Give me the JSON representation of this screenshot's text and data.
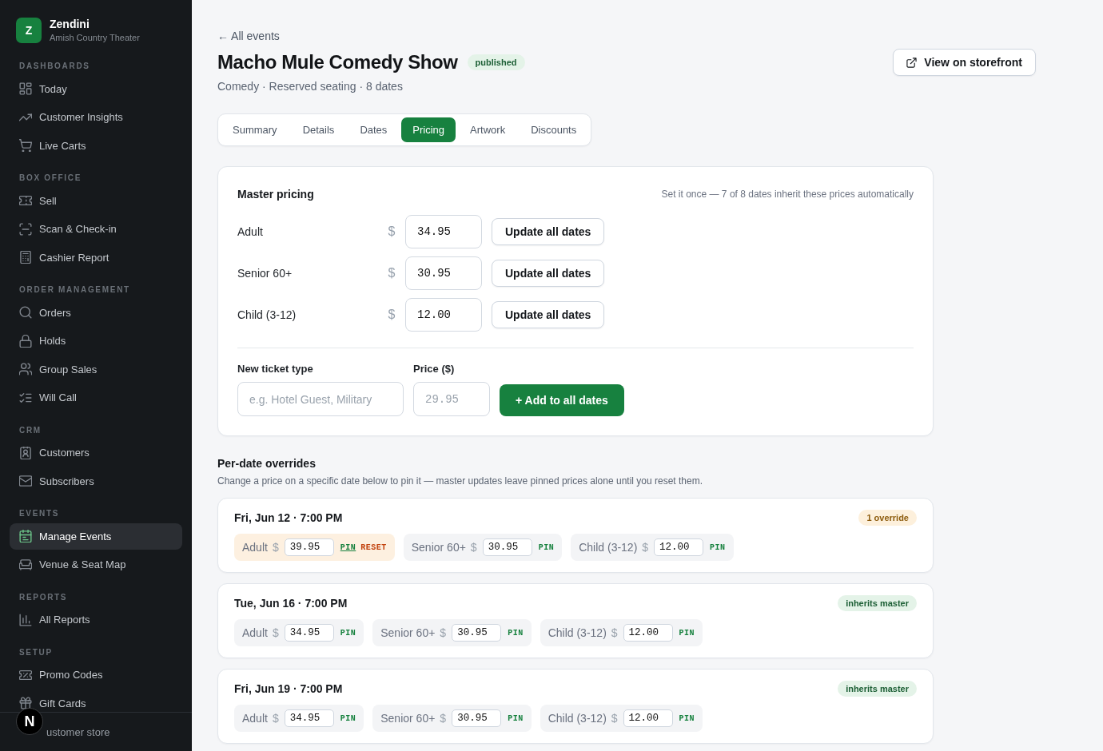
{
  "sidebar": {
    "brand": {
      "logo_letter": "Z",
      "name": "Zendini",
      "subtitle": "Amish Country Theater"
    },
    "sections": [
      {
        "title": "DASHBOARDS",
        "items": [
          {
            "label": "Today",
            "selected": false
          },
          {
            "label": "Customer Insights",
            "selected": false
          },
          {
            "label": "Live Carts",
            "selected": false
          }
        ]
      },
      {
        "title": "BOX OFFICE",
        "items": [
          {
            "label": "Sell",
            "selected": false
          },
          {
            "label": "Scan & Check-in",
            "selected": false
          },
          {
            "label": "Cashier Report",
            "selected": false
          }
        ]
      },
      {
        "title": "ORDER MANAGEMENT",
        "items": [
          {
            "label": "Orders",
            "selected": false
          },
          {
            "label": "Holds",
            "selected": false
          },
          {
            "label": "Group Sales",
            "selected": false
          },
          {
            "label": "Will Call",
            "selected": false
          }
        ]
      },
      {
        "title": "CRM",
        "items": [
          {
            "label": "Customers",
            "selected": false
          },
          {
            "label": "Subscribers",
            "selected": false
          }
        ]
      },
      {
        "title": "EVENTS",
        "items": [
          {
            "label": "Manage Events",
            "selected": true
          },
          {
            "label": "Venue & Seat Map",
            "selected": false
          }
        ]
      },
      {
        "title": "REPORTS",
        "items": [
          {
            "label": "All Reports",
            "selected": false
          }
        ]
      },
      {
        "title": "SETUP",
        "items": [
          {
            "label": "Promo Codes",
            "selected": false
          },
          {
            "label": "Gift Cards",
            "selected": false
          }
        ]
      }
    ],
    "footer": {
      "label": "ustomer store"
    }
  },
  "dev_badge": {
    "label": "N"
  },
  "header": {
    "back_link": "← All events",
    "title": "Macho Mule Comedy Show",
    "status": "published",
    "subtitle": "Comedy · Reserved seating · 8 dates",
    "storefront_button": "View on storefront"
  },
  "tabs": [
    {
      "label": "Summary",
      "selected": false
    },
    {
      "label": "Details",
      "selected": false
    },
    {
      "label": "Dates",
      "selected": false
    },
    {
      "label": "Pricing",
      "selected": true
    },
    {
      "label": "Artwork",
      "selected": false
    },
    {
      "label": "Discounts",
      "selected": false
    }
  ],
  "master_pricing": {
    "title": "Master pricing",
    "hint": "Set it once — 7 of 8 dates inherit these prices automatically",
    "rows": [
      {
        "label": "Adult",
        "currency": "$",
        "value": "34.95",
        "button": "Update all dates"
      },
      {
        "label": "Senior 60+",
        "currency": "$",
        "value": "30.95",
        "button": "Update all dates"
      },
      {
        "label": "Child (3-12)",
        "currency": "$",
        "value": "12.00",
        "button": "Update all dates"
      }
    ],
    "new_ticket": {
      "name_field": {
        "label": "New ticket type",
        "placeholder": "e.g. Hotel Guest, Military"
      },
      "price_field": {
        "label": "Price ($)",
        "placeholder": "29.95"
      },
      "button": "+ Add to all dates"
    }
  },
  "overrides": {
    "title": "Per-date overrides",
    "description": "Change a price on a specific date below to pin it — master updates leave pinned prices alone until you reset them.",
    "dates": [
      {
        "title": "Fri, Jun 12 · 7:00 PM",
        "badge": {
          "label": "1 override",
          "kind": "override"
        },
        "prices": [
          {
            "label": "Adult",
            "currency": "$",
            "value": "39.95",
            "pin": "PIN",
            "pinned": true,
            "reset": "RESET"
          },
          {
            "label": "Senior 60+",
            "currency": "$",
            "value": "30.95",
            "pin": "PIN",
            "pinned": false
          },
          {
            "label": "Child (3-12)",
            "currency": "$",
            "value": "12.00",
            "pin": "PIN",
            "pinned": false
          }
        ]
      },
      {
        "title": "Tue, Jun 16 · 7:00 PM",
        "badge": {
          "label": "inherits master",
          "kind": "inherits"
        },
        "prices": [
          {
            "label": "Adult",
            "currency": "$",
            "value": "34.95",
            "pin": "PIN",
            "pinned": false
          },
          {
            "label": "Senior 60+",
            "currency": "$",
            "value": "30.95",
            "pin": "PIN",
            "pinned": false
          },
          {
            "label": "Child (3-12)",
            "currency": "$",
            "value": "12.00",
            "pin": "PIN",
            "pinned": false
          }
        ]
      },
      {
        "title": "Fri, Jun 19 · 7:00 PM",
        "badge": {
          "label": "inherits master",
          "kind": "inherits"
        },
        "prices": [
          {
            "label": "Adult",
            "currency": "$",
            "value": "34.95",
            "pin": "PIN",
            "pinned": false
          },
          {
            "label": "Senior 60+",
            "currency": "$",
            "value": "30.95",
            "pin": "PIN",
            "pinned": false
          },
          {
            "label": "Child (3-12)",
            "currency": "$",
            "value": "12.00",
            "pin": "PIN",
            "pinned": false
          }
        ]
      }
    ]
  }
}
